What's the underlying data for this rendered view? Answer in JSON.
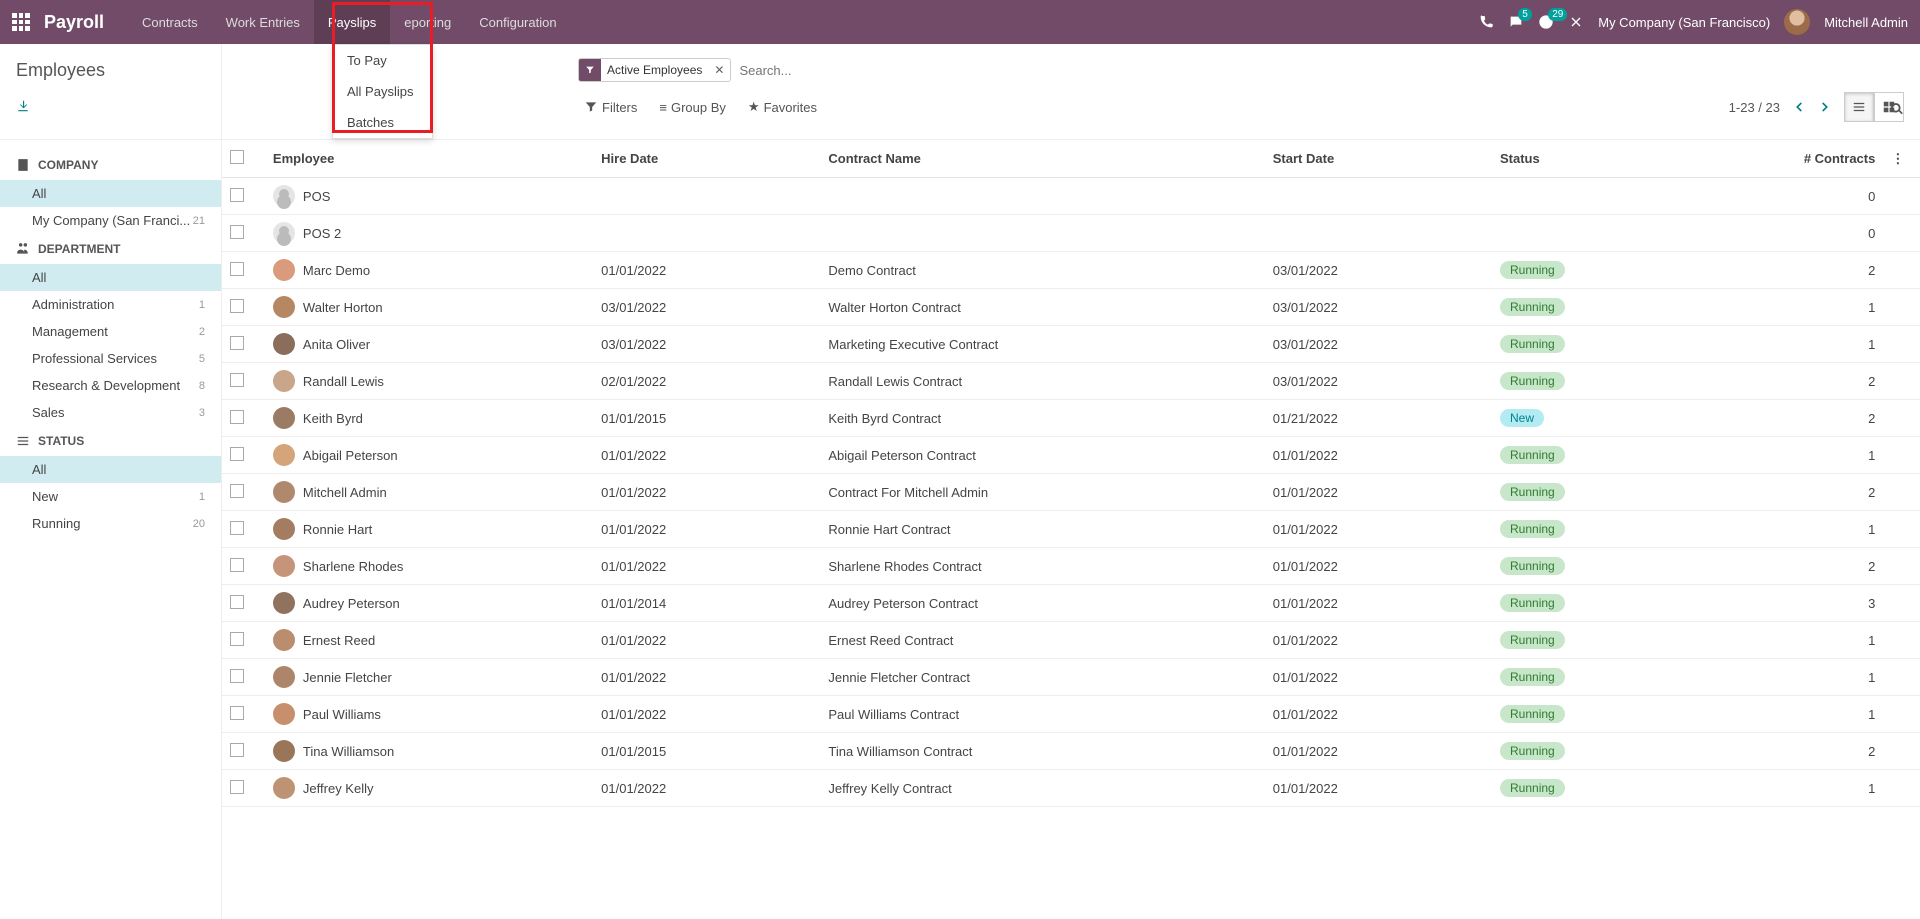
{
  "header": {
    "brand": "Payroll",
    "menu": [
      "Contracts",
      "Work Entries",
      "Payslips",
      "eporting",
      "Configuration"
    ],
    "active_menu": "Payslips",
    "msg_badge": "5",
    "clock_badge": "29",
    "company": "My Company (San Francisco)",
    "user": "Mitchell Admin"
  },
  "dropdown": [
    "To Pay",
    "All Payslips",
    "Batches"
  ],
  "page_title": "Employees",
  "search": {
    "facet_label": "Active Employees",
    "placeholder": "Search..."
  },
  "controls": {
    "filters": "Filters",
    "groupby": "Group By",
    "favorites": "Favorites",
    "pager": "1-23 / 23"
  },
  "sidebar": {
    "groups": [
      {
        "title": "COMPANY",
        "icon": "building",
        "items": [
          {
            "label": "All",
            "count": "",
            "selected": true
          },
          {
            "label": "My Company (San Franci...",
            "count": "21"
          }
        ]
      },
      {
        "title": "DEPARTMENT",
        "icon": "users",
        "items": [
          {
            "label": "All",
            "count": "",
            "selected": true
          },
          {
            "label": "Administration",
            "count": "1"
          },
          {
            "label": "Management",
            "count": "2"
          },
          {
            "label": "Professional Services",
            "count": "5"
          },
          {
            "label": "Research & Development",
            "count": "8"
          },
          {
            "label": "Sales",
            "count": "3"
          }
        ]
      },
      {
        "title": "STATUS",
        "icon": "bars",
        "items": [
          {
            "label": "All",
            "count": "",
            "selected": true
          },
          {
            "label": "New",
            "count": "1"
          },
          {
            "label": "Running",
            "count": "20"
          }
        ]
      }
    ]
  },
  "table": {
    "columns": [
      "Employee",
      "Hire Date",
      "Contract Name",
      "Start Date",
      "Status",
      "# Contracts"
    ],
    "rows": [
      {
        "employee": "POS",
        "placeholder": true,
        "hire": "",
        "contract": "",
        "start": "",
        "status": "",
        "n": "0"
      },
      {
        "employee": "POS 2",
        "placeholder": true,
        "hire": "",
        "contract": "",
        "start": "",
        "status": "",
        "n": "0"
      },
      {
        "employee": "Marc Demo",
        "hire": "01/01/2022",
        "contract": "Demo Contract",
        "start": "03/01/2022",
        "status": "Running",
        "n": "2"
      },
      {
        "employee": "Walter Horton",
        "hire": "03/01/2022",
        "contract": "Walter Horton Contract",
        "start": "03/01/2022",
        "status": "Running",
        "n": "1"
      },
      {
        "employee": "Anita Oliver",
        "hire": "03/01/2022",
        "contract": "Marketing Executive Contract",
        "start": "03/01/2022",
        "status": "Running",
        "n": "1"
      },
      {
        "employee": "Randall Lewis",
        "hire": "02/01/2022",
        "contract": "Randall Lewis Contract",
        "start": "03/01/2022",
        "status": "Running",
        "n": "2"
      },
      {
        "employee": "Keith Byrd",
        "hire": "01/01/2015",
        "contract": "Keith Byrd Contract",
        "start": "01/21/2022",
        "status": "New",
        "n": "2"
      },
      {
        "employee": "Abigail Peterson",
        "hire": "01/01/2022",
        "contract": "Abigail Peterson Contract",
        "start": "01/01/2022",
        "status": "Running",
        "n": "1"
      },
      {
        "employee": "Mitchell Admin",
        "hire": "01/01/2022",
        "contract": "Contract For Mitchell Admin",
        "start": "01/01/2022",
        "status": "Running",
        "n": "2"
      },
      {
        "employee": "Ronnie Hart",
        "hire": "01/01/2022",
        "contract": "Ronnie Hart Contract",
        "start": "01/01/2022",
        "status": "Running",
        "n": "1"
      },
      {
        "employee": "Sharlene Rhodes",
        "hire": "01/01/2022",
        "contract": "Sharlene Rhodes Contract",
        "start": "01/01/2022",
        "status": "Running",
        "n": "2"
      },
      {
        "employee": "Audrey Peterson",
        "hire": "01/01/2014",
        "contract": "Audrey Peterson Contract",
        "start": "01/01/2022",
        "status": "Running",
        "n": "3"
      },
      {
        "employee": "Ernest Reed",
        "hire": "01/01/2022",
        "contract": "Ernest Reed Contract",
        "start": "01/01/2022",
        "status": "Running",
        "n": "1"
      },
      {
        "employee": "Jennie Fletcher",
        "hire": "01/01/2022",
        "contract": "Jennie Fletcher Contract",
        "start": "01/01/2022",
        "status": "Running",
        "n": "1"
      },
      {
        "employee": "Paul Williams",
        "hire": "01/01/2022",
        "contract": "Paul Williams Contract",
        "start": "01/01/2022",
        "status": "Running",
        "n": "1"
      },
      {
        "employee": "Tina Williamson",
        "hire": "01/01/2015",
        "contract": "Tina Williamson Contract",
        "start": "01/01/2022",
        "status": "Running",
        "n": "2"
      },
      {
        "employee": "Jeffrey Kelly",
        "hire": "01/01/2022",
        "contract": "Jeffrey Kelly Contract",
        "start": "01/01/2022",
        "status": "Running",
        "n": "1"
      }
    ]
  }
}
